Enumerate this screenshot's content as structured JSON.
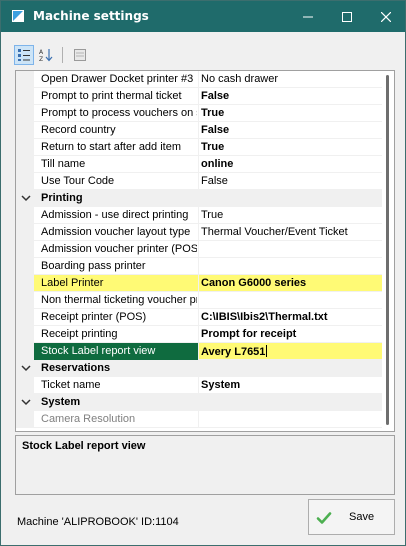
{
  "window": {
    "title": "Machine settings"
  },
  "grid": {
    "rows_top": [
      {
        "name": "Open Drawer Docket printer #3",
        "value": "No cash drawer",
        "bold": false
      },
      {
        "name": "Prompt to print thermal ticket",
        "value": "False",
        "bold": true
      },
      {
        "name": "Prompt to process vouchers on s",
        "value": "True",
        "bold": true
      },
      {
        "name": "Record country",
        "value": "False",
        "bold": true
      },
      {
        "name": "Return to start after add item",
        "value": "True",
        "bold": true
      },
      {
        "name": "Till name",
        "value": "online",
        "bold": true
      },
      {
        "name": "Use Tour Code",
        "value": "False",
        "bold": false
      }
    ],
    "category_printing": "Printing",
    "rows_printing": [
      {
        "name": "Admission - use direct printing",
        "value": "True"
      },
      {
        "name": "Admission voucher layout type",
        "value": "Thermal Voucher/Event Ticket"
      },
      {
        "name": "Admission voucher printer (POS)",
        "value": ""
      },
      {
        "name": "Boarding pass printer",
        "value": ""
      },
      {
        "name": "Label Printer",
        "value": "Canon G6000 series"
      },
      {
        "name": "Non thermal ticketing voucher pr",
        "value": ""
      },
      {
        "name": "Receipt printer (POS)",
        "value": "C:\\IBIS\\Ibis2\\Thermal.txt"
      },
      {
        "name": "Receipt printing",
        "value": "Prompt for receipt"
      },
      {
        "name": "Stock Label report view",
        "value": "Avery L7651"
      }
    ],
    "category_reservations": "Reservations",
    "rows_reservations": [
      {
        "name": "Ticket name",
        "value": "System"
      }
    ],
    "category_system": "System",
    "rows_system": [
      {
        "name": "Camera Resolution",
        "value": ""
      }
    ]
  },
  "description": {
    "title": "Stock Label report view"
  },
  "footer": {
    "machine_label": "Machine 'ALIPROBOOK' ID:1104",
    "save_label": "Save"
  },
  "colors": {
    "titlebar": "#1f6b6b",
    "highlight": "#fffa75",
    "selected": "#0f6b3f",
    "save_check": "#4caf50"
  }
}
